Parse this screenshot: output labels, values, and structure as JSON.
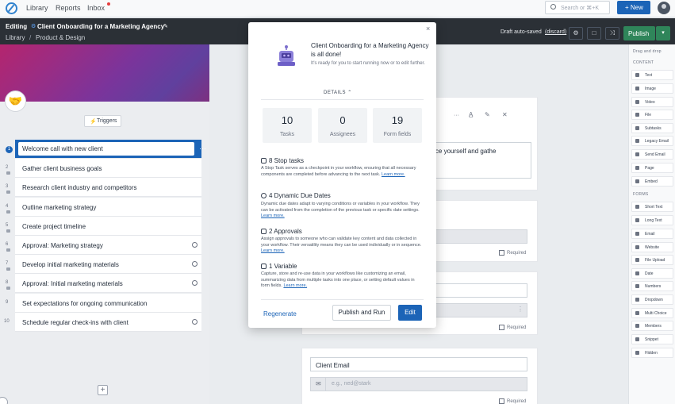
{
  "nav": {
    "library": "Library",
    "reports": "Reports",
    "inbox": "Inbox",
    "search_placeholder": "Search or ⌘+K",
    "new_button": "+ New"
  },
  "editbar": {
    "editing": "Editing",
    "title": "Client Onboarding for a Marketing Agency",
    "breadcrumb_library": "Library",
    "breadcrumb_sep": "/",
    "breadcrumb_folder": "Product & Design",
    "draft_status": "Draft auto-saved",
    "discard": "(discard)",
    "publish": "Publish"
  },
  "left": {
    "triggers": "Triggers",
    "add": "+",
    "tasks": [
      {
        "num": "1",
        "label": "Welcome call with new client",
        "clock": false,
        "active": true
      },
      {
        "num": "2",
        "label": "Gather client business goals",
        "clock": false
      },
      {
        "num": "3",
        "label": "Research client industry and competitors",
        "clock": false
      },
      {
        "num": "4",
        "label": "Outline marketing strategy",
        "clock": false
      },
      {
        "num": "5",
        "label": "Create project timeline",
        "clock": false
      },
      {
        "num": "6",
        "label": "Approval: Marketing strategy",
        "clock": true
      },
      {
        "num": "7",
        "label": "Develop initial marketing materials",
        "clock": true
      },
      {
        "num": "8",
        "label": "Approval: Initial marketing materials",
        "clock": true
      },
      {
        "num": "9",
        "label": "Set expectations for ongoing communication",
        "clock": false
      },
      {
        "num": "10",
        "label": "Schedule regular check-ins with client",
        "clock": true
      }
    ]
  },
  "center": {
    "intro_text": "duce yourself and gathe",
    "required": "Required",
    "client_email_label": "Client Email",
    "email_placeholder": "e.g., ned@stark"
  },
  "right": {
    "drag_hint": "Drag and drop",
    "content_head": "CONTENT",
    "content_items": [
      "Text",
      "Image",
      "Video",
      "File",
      "Subtasks",
      "Legacy Email",
      "Send Email",
      "Page",
      "Embed"
    ],
    "forms_head": "FORMS",
    "form_items": [
      "Short Text",
      "Long Text",
      "Email",
      "Website",
      "File Upload",
      "Date",
      "Numbers",
      "Dropdown",
      "Multi Choice",
      "Members",
      "Snippet",
      "Hidden"
    ]
  },
  "modal": {
    "close": "×",
    "title": "Client Onboarding for a Marketing Agency is all done!",
    "subtitle": "It's ready for you to start running now or to edit further.",
    "details": "DETAILS",
    "stats": [
      {
        "value": "10",
        "label": "Tasks"
      },
      {
        "value": "0",
        "label": "Assignees"
      },
      {
        "value": "19",
        "label": "Form fields"
      }
    ],
    "sections": [
      {
        "title": "8 Stop tasks",
        "body": "A Stop Task serves as a checkpoint in your workflow, ensuring that all necessary components are completed before advancing to the next task.",
        "link": "Learn more."
      },
      {
        "title": "4 Dynamic Due Dates",
        "body": "Dynamic due dates adapt to varying conditions or variables in your workflow. They can be activated from the completion of the previous task or specific date settings.",
        "link": "Learn more."
      },
      {
        "title": "2 Approvals",
        "body": "Assign approvals to someone who can validate key content and data collected in your workflow. Their versatility means they can be used individually or in sequence.",
        "link": "Learn more."
      },
      {
        "title": "1 Variable",
        "body": "Capture, store and re-use data in your workflows like customizing an email, summarizing data from multiple tasks into one place, or setting default values in form fields.",
        "link": "Learn more."
      }
    ],
    "regenerate": "Regenerate",
    "publish_run": "Publish and Run",
    "edit": "Edit"
  }
}
